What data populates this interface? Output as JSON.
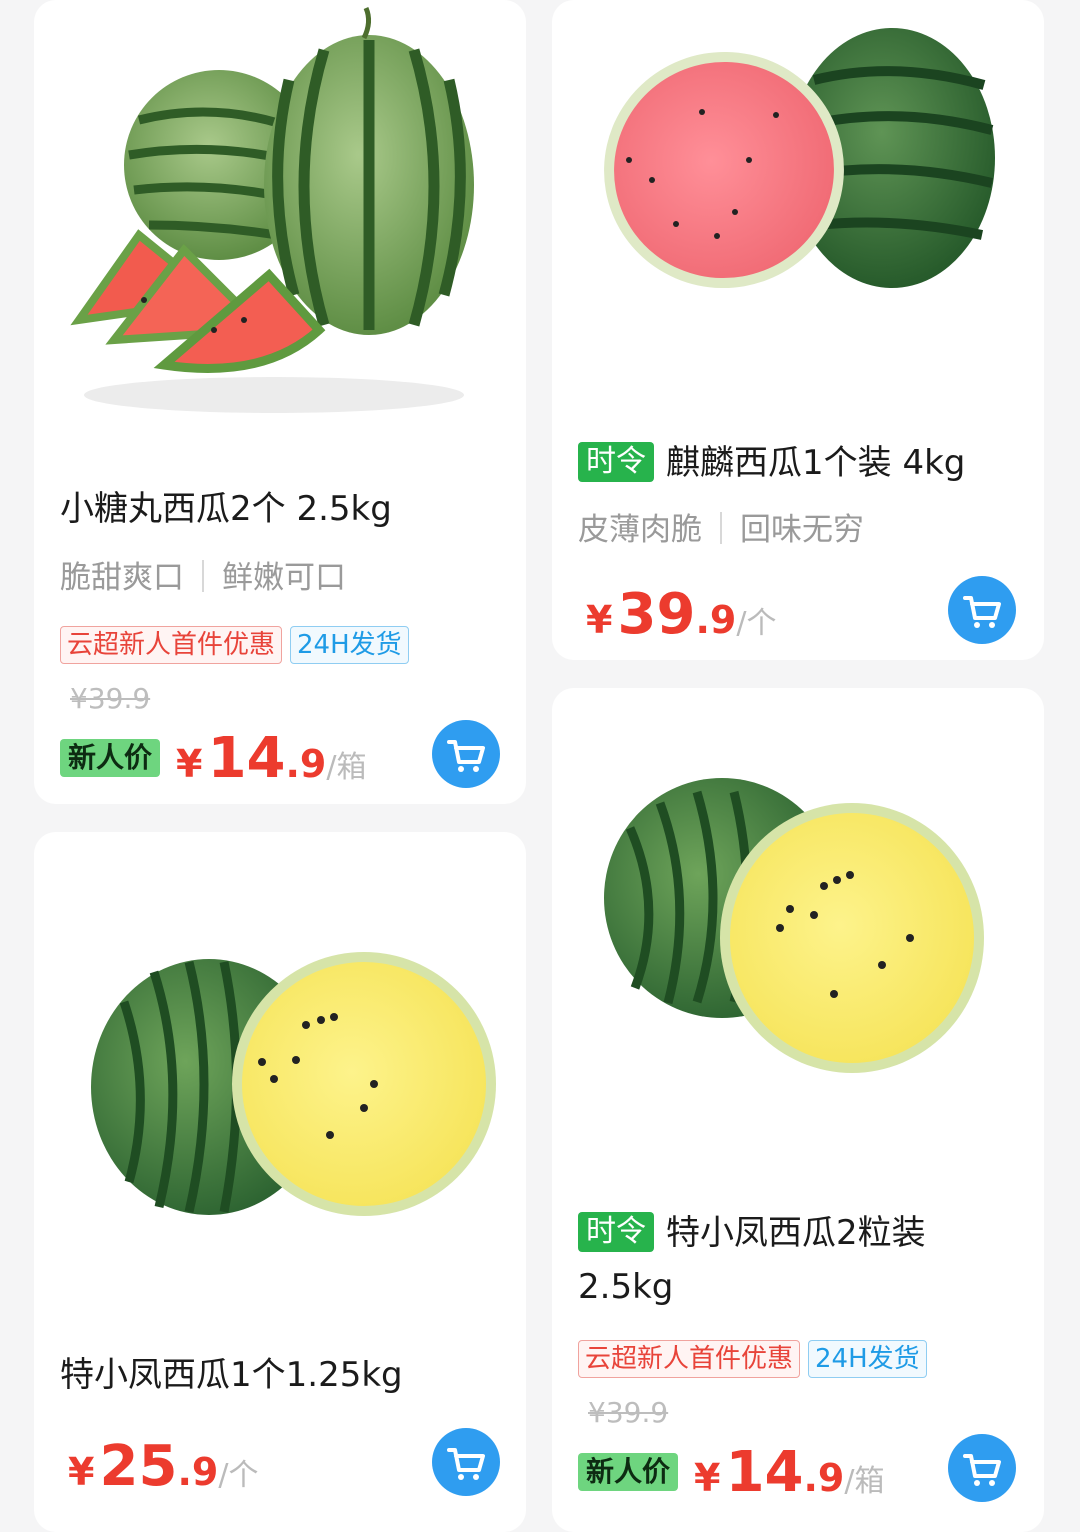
{
  "products": [
    {
      "title": "小糖丸西瓜2个 2.5kg",
      "features": [
        "脆甜爽口",
        "鲜嫩可口"
      ],
      "tags": [
        "云超新人首件优惠",
        "24H发货"
      ],
      "old_price": "¥39.9",
      "price_label": "新人价",
      "currency": "¥",
      "price_int": "14",
      "price_dec": ".9",
      "unit": "/箱"
    },
    {
      "badge": "时令",
      "title": "麒麟西瓜1个装 4kg",
      "features": [
        "皮薄肉脆",
        "回味无穷"
      ],
      "currency": "¥",
      "price_int": "39",
      "price_dec": ".9",
      "unit": "/个"
    },
    {
      "title": "特小凤西瓜1个1.25kg",
      "currency": "¥",
      "price_int": "25",
      "price_dec": ".9",
      "unit": "/个"
    },
    {
      "badge": "时令",
      "title": "特小凤西瓜2粒装 2.5kg",
      "tags": [
        "云超新人首件优惠",
        "24H发货"
      ],
      "old_price": "¥39.9",
      "price_label": "新人价",
      "currency": "¥",
      "price_int": "14",
      "price_dec": ".9",
      "unit": "/箱"
    }
  ],
  "icons": {
    "cart": "shopping-cart-icon"
  },
  "colors": {
    "price": "#ec3b2e",
    "cart": "#2f9df0",
    "season_badge": "#27b34c",
    "newcomer_badge": "#6ed57f"
  }
}
